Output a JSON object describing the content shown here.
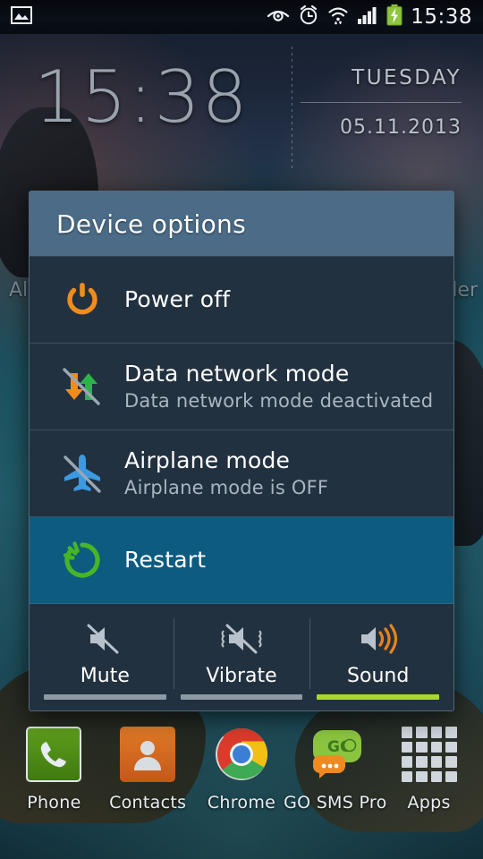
{
  "statusbar": {
    "time": "15:38",
    "left_icons": [
      {
        "name": "gallery-image-icon",
        "glyph": "image"
      }
    ],
    "right_icons": [
      {
        "name": "smart-stay-eye-icon",
        "glyph": "eye"
      },
      {
        "name": "alarm-clock-icon",
        "glyph": "alarm"
      },
      {
        "name": "wifi-icon",
        "glyph": "wifi"
      },
      {
        "name": "cellular-signal-icon",
        "glyph": "signal"
      },
      {
        "name": "battery-charging-icon",
        "glyph": "battery"
      }
    ],
    "battery_color": "#8ec63f"
  },
  "clock_widget": {
    "time": "15:38",
    "day": "TUESDAY",
    "date": "05.11.2013"
  },
  "background_text": {
    "left_fragment": "Al",
    "right_fragment": "der"
  },
  "dialog": {
    "title": "Device options",
    "header_color": "#4b6b86",
    "body_color": "#22313f",
    "highlight_color": "#0e5b80",
    "options": [
      {
        "icon": "power-off-icon",
        "icon_color": "#f08c1e",
        "title": "Power off",
        "subtitle": "",
        "highlighted": false
      },
      {
        "icon": "data-network-mode-icon",
        "icon_color": "#2db34a",
        "title": "Data network mode",
        "subtitle": "Data network mode deactivated",
        "highlighted": false
      },
      {
        "icon": "airplane-mode-icon",
        "icon_color": "#3b9ae1",
        "title": "Airplane mode",
        "subtitle": "Airplane mode is OFF",
        "highlighted": false
      },
      {
        "icon": "restart-icon",
        "icon_color": "#46b526",
        "title": "Restart",
        "subtitle": "",
        "highlighted": true
      }
    ],
    "sound_modes": [
      {
        "icon": "mute-icon",
        "label": "Mute",
        "active": false
      },
      {
        "icon": "vibrate-icon",
        "label": "Vibrate",
        "active": false
      },
      {
        "icon": "sound-icon",
        "label": "Sound",
        "active": true
      }
    ],
    "active_bar_color": "#a8d92b",
    "inactive_bar_color": "#8d9aa6"
  },
  "dock": {
    "items": [
      {
        "icon": "phone-icon",
        "label": "Phone"
      },
      {
        "icon": "contacts-icon",
        "label": "Contacts"
      },
      {
        "icon": "chrome-icon",
        "label": "Chrome"
      },
      {
        "icon": "go-sms-pro-icon",
        "label": "GO SMS Pro"
      },
      {
        "icon": "apps-grid-icon",
        "label": "Apps"
      }
    ]
  }
}
